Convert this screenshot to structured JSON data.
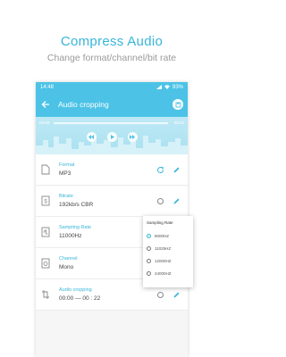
{
  "promo": {
    "headline": "Compress Audio",
    "subheadline": "Change format/channel/bit rate"
  },
  "statusbar": {
    "time": "14:48",
    "battery": "93%"
  },
  "appbar": {
    "title": "Audio cropping",
    "back_icon": "arrow-left-icon",
    "save_icon": "save-icon"
  },
  "player": {
    "time_start": "00:00",
    "time_end": "00:22"
  },
  "settings": [
    {
      "label": "Format",
      "value": "MP3",
      "icon": "file-icon"
    },
    {
      "label": "Bitrate",
      "value": "192kb/s CBR",
      "icon": "bitrate-icon"
    },
    {
      "label": "Sampling Rate",
      "value": "11000Hz",
      "icon": "waveform-icon"
    },
    {
      "label": "Channel",
      "value": "Mono",
      "icon": "speaker-icon"
    },
    {
      "label": "Audio cropping",
      "value": "00:00 — 00 : 22",
      "icon": "crop-icon"
    }
  ],
  "sampling_popup": {
    "title": "Sampling Rate",
    "options": [
      "8000HZ",
      "11025HZ",
      "12000HZ",
      "24000HZ"
    ],
    "selected_index": 0
  },
  "colors": {
    "accent": "#37b5d8",
    "appbar": "#4cc3e6",
    "player_bg": "#bfe9f5"
  }
}
